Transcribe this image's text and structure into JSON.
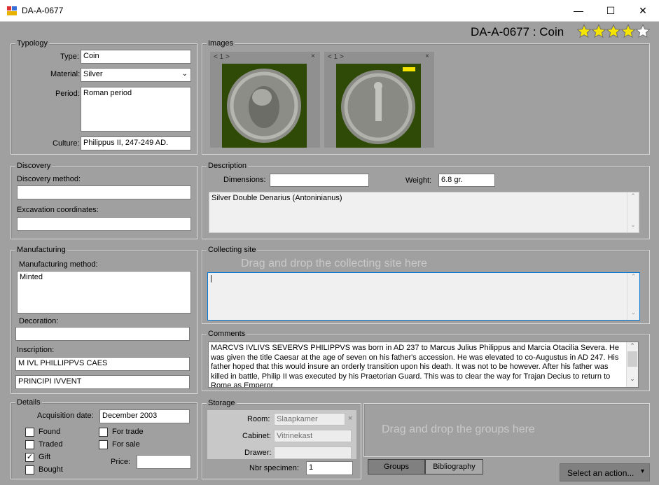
{
  "window": {
    "title": "DA-A-0677",
    "minimize": "—",
    "maximize": "☐",
    "close": "✕"
  },
  "header": {
    "title": "DA-A-0677 : Coin",
    "rating": 4,
    "max_rating": 5
  },
  "typology": {
    "legend": "Typology",
    "type_label": "Type:",
    "type_value": "Coin",
    "material_label": "Material:",
    "material_value": "Silver",
    "period_label": "Period:",
    "period_value": "Roman period",
    "culture_label": "Culture:",
    "culture_value": "Philippus II, 247-249 AD."
  },
  "images": {
    "legend": "Images",
    "thumbs": [
      {
        "nav": "< 1 >",
        "counter": "1",
        "close": "×"
      },
      {
        "nav": "< 1 >",
        "counter": "1",
        "close": "×"
      }
    ]
  },
  "discovery": {
    "legend": "Discovery",
    "method_label": "Discovery method:",
    "method_value": "",
    "coords_label": "Excavation coordinates:",
    "coords_value": ""
  },
  "description": {
    "legend": "Description",
    "dimensions_label": "Dimensions:",
    "dimensions_value": "",
    "weight_label": "Weight:",
    "weight_value": "6.8 gr.",
    "text": "Silver Double Denarius (Antoninianus)"
  },
  "manufacturing": {
    "legend": "Manufacturing",
    "method_label": "Manufacturing method:",
    "method_value": "Minted",
    "decoration_label": "Decoration:",
    "decoration_value": "",
    "inscription_label": "Inscription:",
    "inscription_1": "M IVL PHILLIPPVS CAES",
    "inscription_2": "PRINCIPI IVVENT"
  },
  "collecting_site": {
    "legend": "Collecting site",
    "hint": "Drag and drop the collecting site here",
    "value": "|"
  },
  "comments": {
    "legend": "Comments",
    "text": "MARCVS IVLIVS SEVERVS PHILIPPVS was born in AD 237 to Marcus Julius Philippus and Marcia Otacilia Severa.  He was given the title Caesar at the age of seven on his father's accession.  He was elevated to co-Augustus in AD 247. His father hoped that this would insure an orderly transition upon his death.  It was not to be however.  After his father was killed in battle,  Philip II was executed by his Praetorian Guard.  This was to clear the way for Trajan Decius to return to Rome as Emperor."
  },
  "details": {
    "legend": "Details",
    "acq_label": "Acquisition date:",
    "acq_value": "December 2003",
    "found": {
      "label": "Found",
      "checked": false
    },
    "traded": {
      "label": "Traded",
      "checked": false
    },
    "gift": {
      "label": "Gift",
      "checked": true
    },
    "bought": {
      "label": "Bought",
      "checked": false
    },
    "fortrade": {
      "label": "For trade",
      "checked": false
    },
    "forsale": {
      "label": "For sale",
      "checked": false
    },
    "price_label": "Price:",
    "price_value": ""
  },
  "storage": {
    "legend": "Storage",
    "room_label": "Room:",
    "room_value": "Slaapkamer",
    "cabinet_label": "Cabinet:",
    "cabinet_value": "Vitrinekast",
    "drawer_label": "Drawer:",
    "drawer_value": "",
    "specimen_label": "Nbr specimen:",
    "specimen_value": "1",
    "clear": "×"
  },
  "groups": {
    "hint": "Drag and drop the groups here",
    "tab_groups": "Groups",
    "tab_bibliography": "Bibliography"
  },
  "action": {
    "label": "Select an action...",
    "arrow": "▾"
  },
  "colors": {
    "background": "#a0a0a0",
    "star": "#f5e400",
    "coin_bg": "#2e4a06",
    "focus": "#0078d7"
  }
}
